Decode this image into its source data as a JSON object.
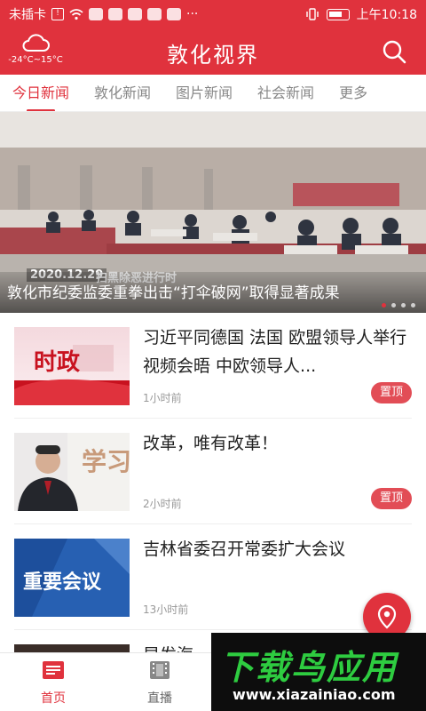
{
  "status_bar": {
    "carrier": "未插卡",
    "time": "上午10:18"
  },
  "header": {
    "title": "敦化视界",
    "weather_temp": "-24°C~15°C"
  },
  "tabs": [
    {
      "label": "今日新闻",
      "active": true
    },
    {
      "label": "敦化新闻",
      "active": false
    },
    {
      "label": "图片新闻",
      "active": false
    },
    {
      "label": "社会新闻",
      "active": false
    },
    {
      "label": "更多",
      "active": false
    }
  ],
  "banner": {
    "date": "2020.12.29",
    "tag": "扫黑除恶进行时",
    "title": "敦化市纪委监委重拳出击“打伞破网”取得显著成果",
    "dots": 4,
    "active_dot": 0
  },
  "news": [
    {
      "title": "习近平同德国 法国 欧盟领导人举行视频会晤 中欧领导人...",
      "time": "1小时前",
      "badge": "置顶",
      "thumb_text": "时政",
      "thumb": "shizheng"
    },
    {
      "title": "改革，唯有改革！",
      "time": "2小时前",
      "badge": "置顶",
      "thumb_text": "学习",
      "thumb": "portrait"
    },
    {
      "title": "吉林省委召开常委扩大会议",
      "time": "13小时前",
      "badge": "",
      "thumb_text": "重要会议",
      "thumb": "meeting"
    },
    {
      "title": "早发海",
      "time": "",
      "badge": "",
      "thumb_text": "",
      "thumb": "partial"
    }
  ],
  "bottom_nav": [
    {
      "label": "首页",
      "icon": "home-icon",
      "active": true
    },
    {
      "label": "直播",
      "icon": "film-icon",
      "active": false
    }
  ],
  "watermark": {
    "text": "下载鸟应用",
    "url": "www.xiazainiao.com"
  },
  "colors": {
    "brand": "#e0323d",
    "badge": "#e24d56",
    "watermark_green": "#2ecc40"
  }
}
